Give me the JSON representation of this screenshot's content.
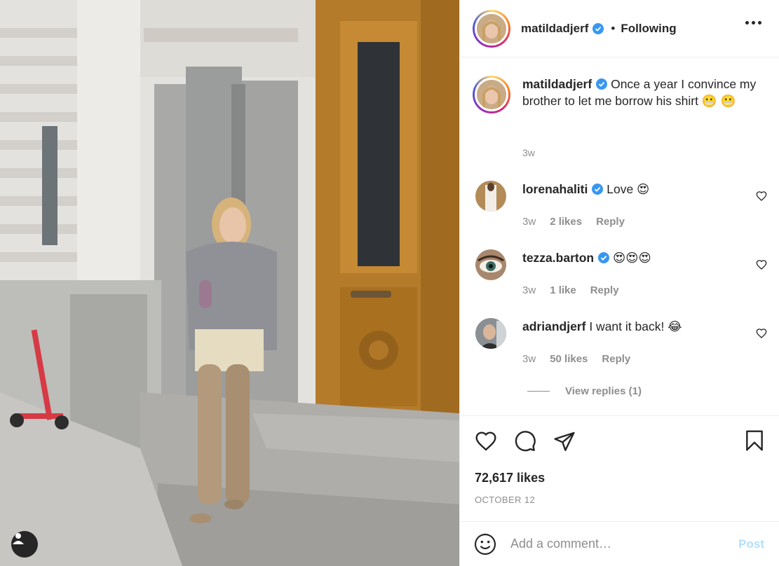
{
  "post": {
    "author": "matildadjerf",
    "follow_state": "Following",
    "dot": "•",
    "caption": "Once a year I convince my brother to let me borrow his shirt 😬 😬",
    "caption_time": "3w"
  },
  "comments": [
    {
      "user": "lorenahaliti",
      "verified": true,
      "text": "Love 😍",
      "time": "3w",
      "likes": "2 likes",
      "reply": "Reply"
    },
    {
      "user": "tezza.barton",
      "verified": true,
      "text": "😍😍😍",
      "time": "3w",
      "likes": "1 like",
      "reply": "Reply"
    },
    {
      "user": "adriandjerf",
      "verified": false,
      "text": "I want it back! 😂",
      "time": "3w",
      "likes": "50 likes",
      "reply": "Reply"
    }
  ],
  "view_replies": "View replies (1)",
  "likes": "72,617 likes",
  "date": "OCTOBER 12",
  "add_comment": {
    "placeholder": "Add a comment…",
    "post_label": "Post"
  },
  "icons": [
    "heart-icon",
    "comment-icon",
    "share-icon",
    "bookmark-icon",
    "emoji-icon",
    "more-icon",
    "verified-badge-icon",
    "user-tag-icon"
  ],
  "colors": {
    "verified": "#3897f0",
    "post_button": "#b2dffc",
    "muted_text": "#8e8e8e",
    "text": "#262626"
  }
}
